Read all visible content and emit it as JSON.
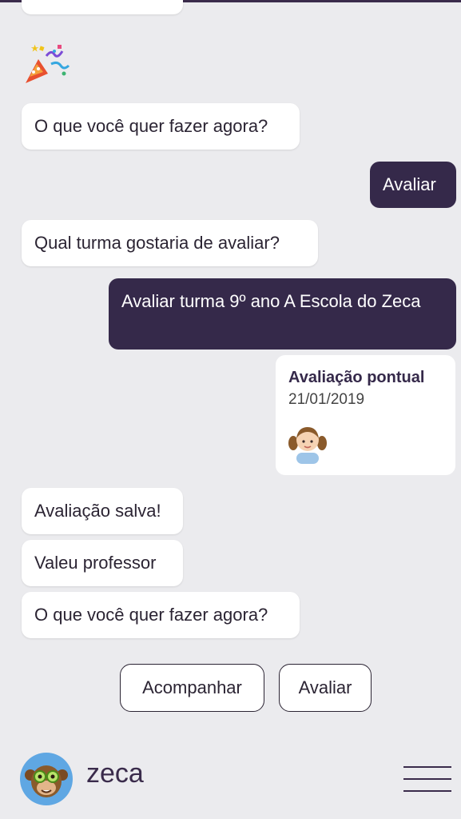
{
  "messages": {
    "m1_bot": "O que você quer fazer agora?",
    "m2_user": "Avaliar",
    "m3_bot": "Qual turma gostaria de avaliar?",
    "m4_user": "Avaliar turma 9º ano A Escola do Zeca",
    "m5_bot": "Avaliação salva!",
    "m6_bot": "Valeu professor",
    "m7_bot": "O que você quer fazer agora?"
  },
  "card": {
    "title": "Avaliação pontual",
    "date": "21/01/2019"
  },
  "quick_replies": {
    "acompanhar": "Acompanhar",
    "avaliar": "Avaliar"
  },
  "footer": {
    "brand": "zeca"
  },
  "colors": {
    "background": "#ebebee",
    "user_bubble": "#35294a",
    "bot_bubble": "#ffffff",
    "brand": "#3a2b4b"
  },
  "icons": {
    "celebration": "party-popper-icon",
    "student": "student-girl-avatar",
    "bot_avatar": "monkey-avatar",
    "menu": "hamburger-menu-icon"
  }
}
